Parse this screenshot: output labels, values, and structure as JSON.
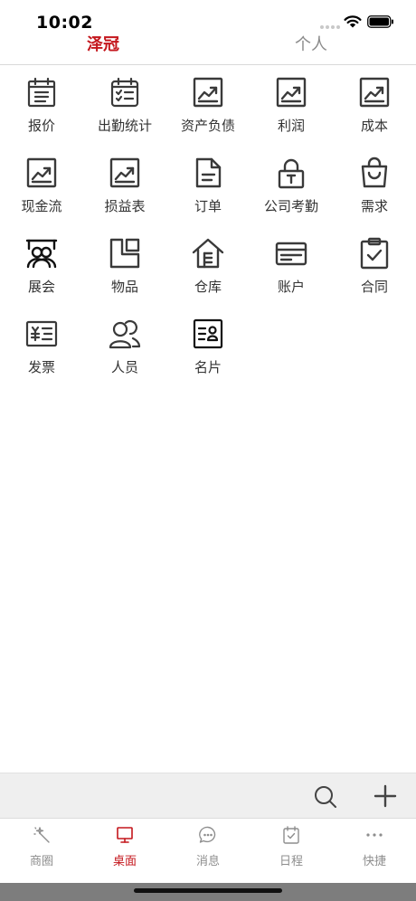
{
  "status_bar": {
    "time": "10:02"
  },
  "tabs": [
    {
      "label": "泽冠",
      "active": true
    },
    {
      "label": "个人",
      "active": false
    }
  ],
  "grid": {
    "items": [
      {
        "label": "报价",
        "icon": "calendar-list-icon"
      },
      {
        "label": "出勤统计",
        "icon": "calendar-check-icon"
      },
      {
        "label": "资产负债",
        "icon": "trend-chart-icon"
      },
      {
        "label": "利润",
        "icon": "trend-chart-icon"
      },
      {
        "label": "成本",
        "icon": "trend-chart-icon"
      },
      {
        "label": "现金流",
        "icon": "trend-chart-icon"
      },
      {
        "label": "损益表",
        "icon": "trend-chart-icon"
      },
      {
        "label": "订单",
        "icon": "document-icon"
      },
      {
        "label": "公司考勤",
        "icon": "lock-icon"
      },
      {
        "label": "需求",
        "icon": "shopping-bag-icon"
      },
      {
        "label": "展会",
        "icon": "exhibition-icon"
      },
      {
        "label": "物品",
        "icon": "items-icon"
      },
      {
        "label": "仓库",
        "icon": "warehouse-icon"
      },
      {
        "label": "账户",
        "icon": "card-icon"
      },
      {
        "label": "合同",
        "icon": "clipboard-check-icon"
      },
      {
        "label": "发票",
        "icon": "invoice-icon"
      },
      {
        "label": "人员",
        "icon": "people-icon"
      },
      {
        "label": "名片",
        "icon": "business-card-icon"
      }
    ]
  },
  "toolbar": {
    "search_icon": "search-icon",
    "add_icon": "plus-icon"
  },
  "tabbar": {
    "items": [
      {
        "label": "商圈",
        "icon": "magic-wand-icon",
        "active": false
      },
      {
        "label": "桌面",
        "icon": "monitor-icon",
        "active": true
      },
      {
        "label": "消息",
        "icon": "chat-bubble-icon",
        "active": false
      },
      {
        "label": "日程",
        "icon": "calendar-icon",
        "active": false
      },
      {
        "label": "快捷",
        "icon": "more-dots-icon",
        "active": false
      }
    ]
  },
  "colors": {
    "accent": "#c4161c",
    "icon": "#3a3a3a",
    "inactive": "#8e8e8e",
    "toolbar_bg": "#efefef"
  }
}
